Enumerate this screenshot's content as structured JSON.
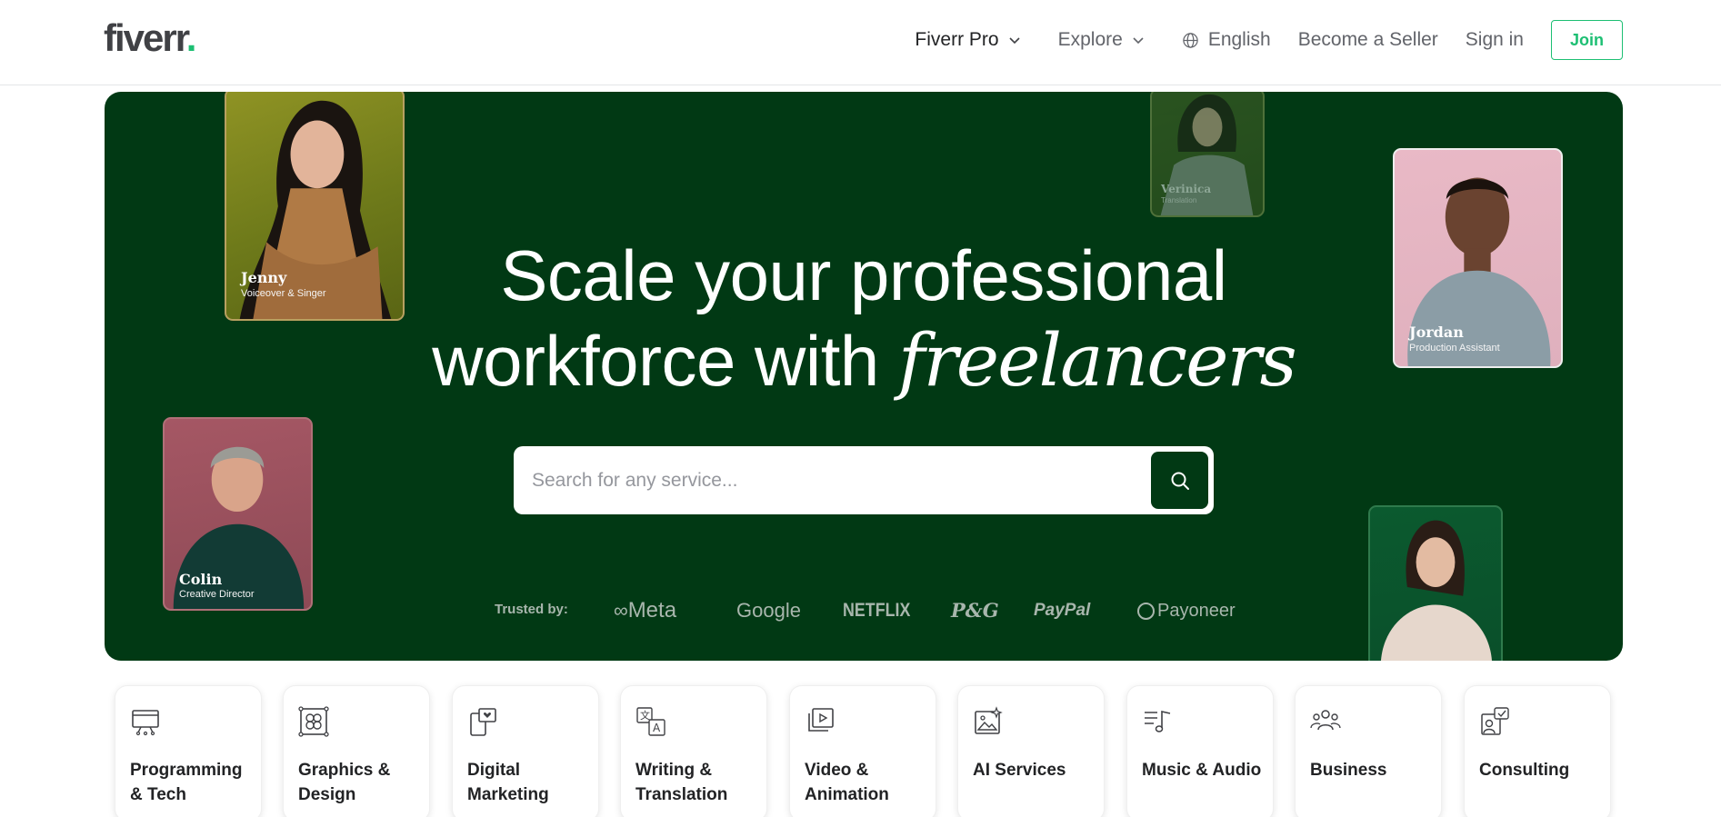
{
  "header": {
    "logo_text": "fiverr",
    "logo_dot": ".",
    "nav": {
      "fiverr_pro": "Fiverr Pro",
      "explore": "Explore",
      "language": "English",
      "become_seller": "Become a Seller",
      "sign_in": "Sign in",
      "join": "Join"
    }
  },
  "hero": {
    "title_line1": "Scale your professional",
    "title_line2_plain": "workforce with ",
    "title_line2_italic": "freelancers",
    "search": {
      "placeholder": "Search for any service..."
    },
    "trusted_label": "Trusted by:",
    "brands": [
      "Meta",
      "Google",
      "NETFLIX",
      "P&G",
      "PayPal",
      "Payoneer"
    ],
    "people": [
      {
        "name": "Jenny",
        "role": "Voiceover & Singer"
      },
      {
        "name": "Verinica",
        "role": "Translation"
      },
      {
        "name": "Jordan",
        "role": "Production Assistant"
      },
      {
        "name": "Colin",
        "role": "Creative Director"
      }
    ]
  },
  "categories": [
    {
      "label": "Programming & Tech",
      "icon": "monitor-icon"
    },
    {
      "label": "Graphics & Design",
      "icon": "design-frame-icon"
    },
    {
      "label": "Digital Marketing",
      "icon": "phone-heart-icon"
    },
    {
      "label": "Writing & Translation",
      "icon": "translate-icon"
    },
    {
      "label": "Video & Animation",
      "icon": "video-play-icon"
    },
    {
      "label": "AI Services",
      "icon": "ai-image-icon"
    },
    {
      "label": "Music & Audio",
      "icon": "music-note-icon"
    },
    {
      "label": "Business",
      "icon": "people-group-icon"
    },
    {
      "label": "Consulting",
      "icon": "consulting-icon"
    }
  ],
  "colors": {
    "brand_green": "#1dbf73",
    "hero_bg": "#013914"
  }
}
